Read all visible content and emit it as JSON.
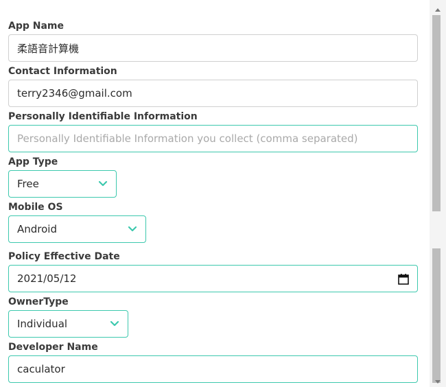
{
  "form": {
    "app_name": {
      "label": "App Name",
      "value": "柔語音計算機"
    },
    "contact": {
      "label": "Contact Information",
      "value": "terry2346@gmail.com"
    },
    "pii": {
      "label": "Personally Identifiable Information",
      "placeholder": "Personally Identifiable Information you collect (comma separated)"
    },
    "app_type": {
      "label": "App Type",
      "value": "Free"
    },
    "mobile_os": {
      "label": "Mobile OS",
      "value": "Android"
    },
    "policy_date": {
      "label": "Policy Effective Date",
      "value": "2021/05/12"
    },
    "owner_type": {
      "label": "OwnerType",
      "value": "Individual"
    },
    "developer_name": {
      "label": "Developer Name",
      "value": "caculator"
    }
  },
  "icons": {
    "select": "chevron-down-icon",
    "date": "calendar-icon",
    "scroll_up": "scroll-up-arrow-icon",
    "scroll_down": "scroll-down-arrow-icon"
  },
  "colors": {
    "accent": "#3cc8ad",
    "border": "#cfcfcf",
    "placeholder": "#a9a9a9",
    "label": "#3a3a3a"
  }
}
